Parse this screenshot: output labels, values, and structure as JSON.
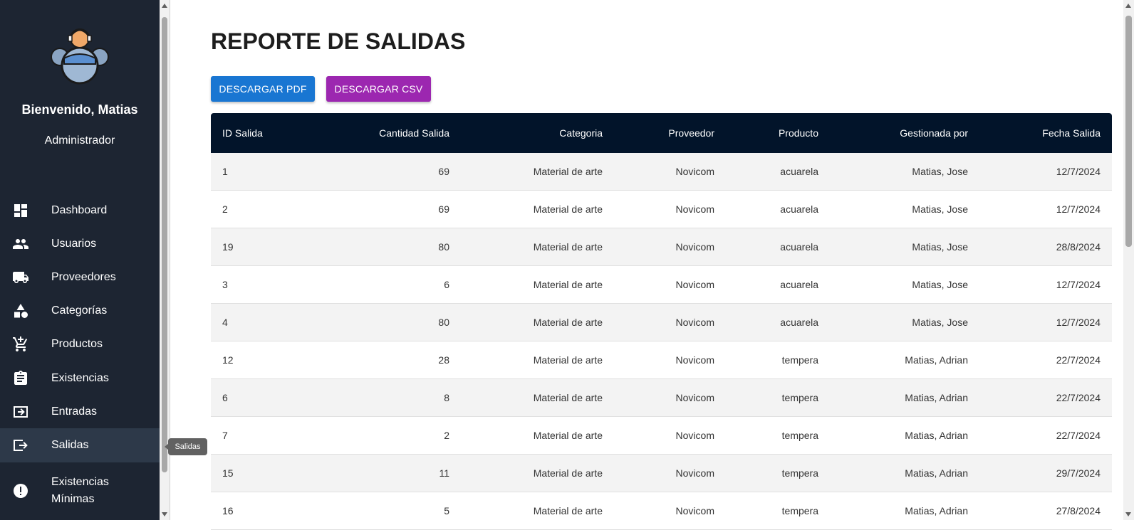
{
  "sidebar": {
    "welcome": "Bienvenido, Matias",
    "role": "Administrador",
    "items": [
      {
        "label": "Dashboard",
        "icon": "dashboard-icon"
      },
      {
        "label": "Usuarios",
        "icon": "users-icon"
      },
      {
        "label": "Proveedores",
        "icon": "truck-icon"
      },
      {
        "label": "Categorías",
        "icon": "category-icon"
      },
      {
        "label": "Productos",
        "icon": "cart-icon"
      },
      {
        "label": "Existencias",
        "icon": "clipboard-icon"
      },
      {
        "label": "Entradas",
        "icon": "login-icon"
      },
      {
        "label": "Salidas",
        "icon": "logout-icon"
      },
      {
        "label": "Existencias Mínimas",
        "icon": "alert-icon"
      }
    ],
    "active": "Salidas",
    "tooltip": "Salidas"
  },
  "main": {
    "title": "REPORTE DE SALIDAS",
    "buttons": {
      "pdf": "DESCARGAR PDF",
      "csv": "DESCARGAR CSV"
    },
    "colors": {
      "sidebar_bg": "#1d2532",
      "header_bg": "#02142a",
      "pdf_button": "#1976d2",
      "csv_button": "#9c27b0"
    }
  },
  "table": {
    "headers": [
      "ID Salida",
      "Cantidad Salida",
      "Categoria",
      "Proveedor",
      "Producto",
      "Gestionada por",
      "Fecha Salida"
    ],
    "rows": [
      [
        "1",
        "69",
        "Material de arte",
        "Novicom",
        "acuarela",
        "Matias, Jose",
        "12/7/2024"
      ],
      [
        "2",
        "69",
        "Material de arte",
        "Novicom",
        "acuarela",
        "Matias, Jose",
        "12/7/2024"
      ],
      [
        "19",
        "80",
        "Material de arte",
        "Novicom",
        "acuarela",
        "Matias, Jose",
        "28/8/2024"
      ],
      [
        "3",
        "6",
        "Material de arte",
        "Novicom",
        "acuarela",
        "Matias, Jose",
        "12/7/2024"
      ],
      [
        "4",
        "80",
        "Material de arte",
        "Novicom",
        "acuarela",
        "Matias, Jose",
        "12/7/2024"
      ],
      [
        "12",
        "28",
        "Material de arte",
        "Novicom",
        "tempera",
        "Matias, Adrian",
        "22/7/2024"
      ],
      [
        "6",
        "8",
        "Material de arte",
        "Novicom",
        "tempera",
        "Matias, Adrian",
        "22/7/2024"
      ],
      [
        "7",
        "2",
        "Material de arte",
        "Novicom",
        "tempera",
        "Matias, Adrian",
        "22/7/2024"
      ],
      [
        "15",
        "11",
        "Material de arte",
        "Novicom",
        "tempera",
        "Matias, Adrian",
        "29/7/2024"
      ],
      [
        "16",
        "5",
        "Material de arte",
        "Novicom",
        "tempera",
        "Matias, Adrian",
        "27/8/2024"
      ]
    ]
  }
}
